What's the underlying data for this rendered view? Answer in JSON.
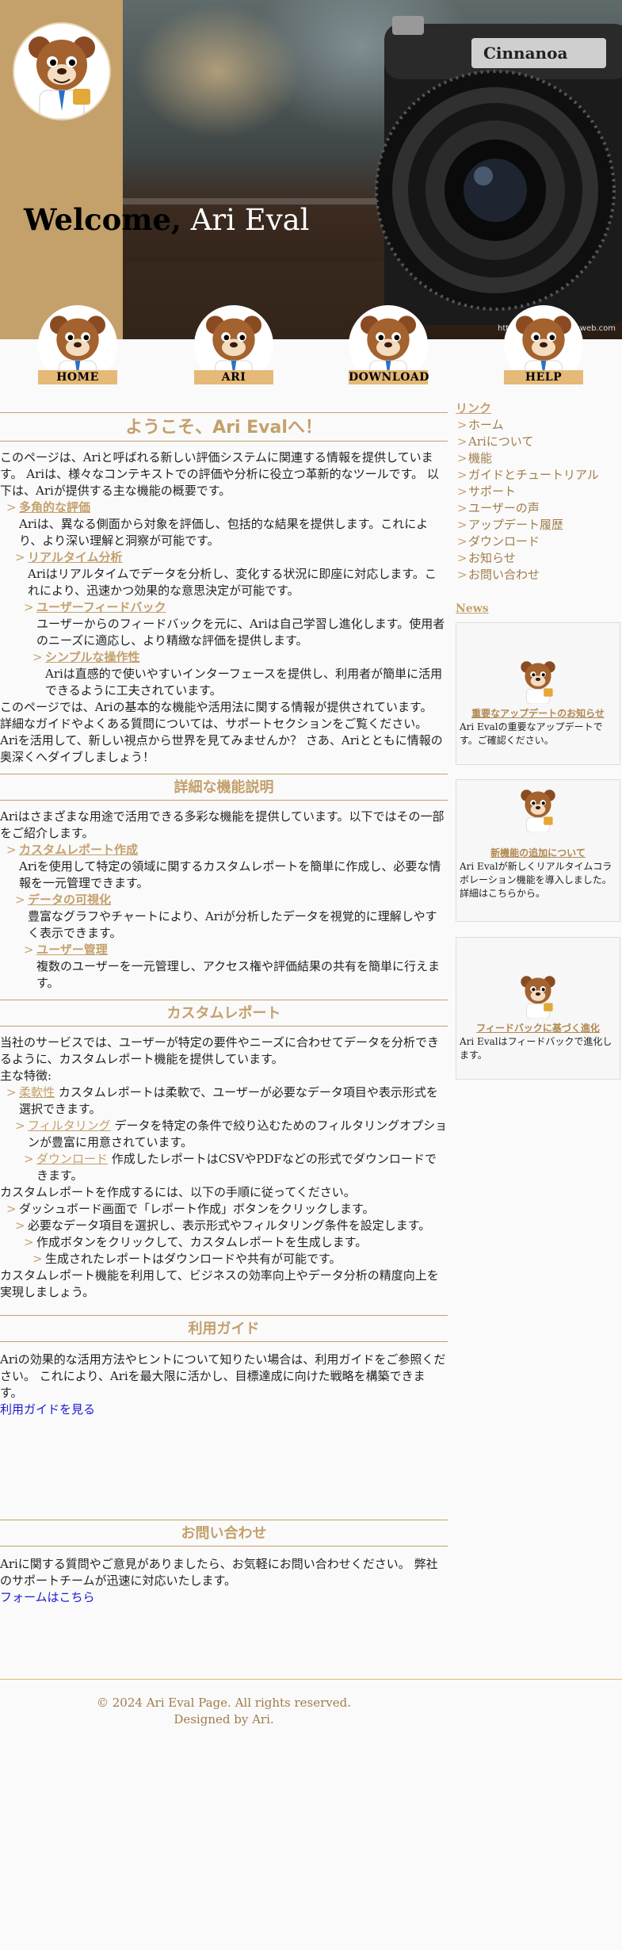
{
  "header": {
    "welcome_word": "Welcome,",
    "welcome_name": "Ari Eval",
    "camera_brand": "Cinnanoa",
    "watermark": "https://www.ari.openweb.com"
  },
  "nav": [
    {
      "label": "HOME"
    },
    {
      "label": "ARI"
    },
    {
      "label": "DOWNLOAD"
    },
    {
      "label": "HELP"
    }
  ],
  "intro": {
    "title": "ようこそ、Ari Evalへ！",
    "p1": "このページは、Ariと呼ばれる新しい評価システムに関連する情報を提供しています。 Ariは、様々なコンテキストでの評価や分析に役立つ革新的なツールです。 以下は、Ariが提供する主な機能の概要です。",
    "items": [
      {
        "title": "多角的な評価",
        "text": "Ariは、異なる側面から対象を評価し、包括的な結果を提供します。これにより、より深い理解と洞察が可能です。"
      },
      {
        "title": "リアルタイム分析",
        "text": "Ariはリアルタイムでデータを分析し、変化する状況に即座に対応します。これにより、迅速かつ効果的な意思決定が可能です。"
      },
      {
        "title": "ユーザーフィードバック",
        "text": "ユーザーからのフィードバックを元に、Ariは自己学習し進化します。使用者のニーズに適応し、より精緻な評価を提供します。"
      },
      {
        "title": "シンプルな操作性",
        "text": "Ariは直感的で使いやすいインターフェースを提供し、利用者が簡単に活用できるように工夫されています。"
      }
    ],
    "p2": "このページでは、Ariの基本的な機能や活用法に関する情報が提供されています。 詳細なガイドやよくある質問については、サポートセクションをご覧ください。 Ariを活用して、新しい視点から世界を見てみませんか？ さあ、Ariとともに情報の奥深くへダイブしましょう！"
  },
  "features": {
    "title": "詳細な機能説明",
    "p1": "Ariはさまざまな用途で活用できる多彩な機能を提供しています。以下ではその一部をご紹介します。",
    "items": [
      {
        "title": "カスタムレポート作成",
        "text": "Ariを使用して特定の領域に関するカスタムレポートを簡単に作成し、必要な情報を一元管理できます。"
      },
      {
        "title": "データの可視化",
        "text": "豊富なグラフやチャートにより、Ariが分析したデータを視覚的に理解しやすく表示できます。"
      },
      {
        "title": "ユーザー管理",
        "text": "複数のユーザーを一元管理し、アクセス権や評価結果の共有を簡単に行えます。"
      }
    ]
  },
  "report": {
    "title": "カスタムレポート",
    "p1": "当社のサービスでは、ユーザーが特定の要件やニーズに合わせてデータを分析できるように、カスタムレポート機能を提供しています。",
    "features_label": "主な特徴:",
    "bullets": [
      {
        "link": "柔軟性",
        "text": "カスタムレポートは柔軟で、ユーザーが必要なデータ項目や表示形式を選択できます。"
      },
      {
        "link": "フィルタリング",
        "text": "データを特定の条件で絞り込むためのフィルタリングオプションが豊富に用意されています。"
      },
      {
        "link": "ダウンロード",
        "text": "作成したレポートはCSVやPDFなどの形式でダウンロードできます。"
      }
    ],
    "steps_intro": "カスタムレポートを作成するには、以下の手順に従ってください。",
    "steps": [
      "ダッシュボード画面で「レポート作成」ボタンをクリックします。",
      "必要なデータ項目を選択し、表示形式やフィルタリング条件を設定します。",
      "作成ボタンをクリックして、カスタムレポートを生成します。",
      "生成されたレポートはダウンロードや共有が可能です。"
    ],
    "p_end": "カスタムレポート機能を利用して、ビジネスの効率向上やデータ分析の精度向上を実現しましょう。"
  },
  "guide": {
    "title": "利用ガイド",
    "p1": "Ariの効果的な活用方法やヒントについて知りたい場合は、利用ガイドをご参照ください。 これにより、Ariを最大限に活かし、目標達成に向けた戦略を構築できます。",
    "link": "利用ガイドを見る"
  },
  "contact": {
    "title": "お問い合わせ",
    "p1": "Ariに関する質問やご意見がありましたら、お気軽にお問い合わせください。 弊社のサポートチームが迅速に対応いたします。",
    "link": "フォームはこちら"
  },
  "sidebar": {
    "links_title": "リンク",
    "links": [
      "ホーム",
      "Ariについて",
      "機能",
      "ガイドとチュートリアル",
      "サポート",
      "ユーザーの声",
      "アップデート履歴",
      "ダウンロード",
      "お知らせ",
      "お問い合わせ"
    ],
    "news_title": "News",
    "news": [
      {
        "title": "重要なアップデートのお知らせ",
        "text": "Ari Evalの重要なアップデートです。ご確認ください。"
      },
      {
        "title": "新機能の追加について",
        "text": "Ari Evalが新しくリアルタイムコラボレーション機能を導入しました。",
        "more": "詳細はこちらから。"
      },
      {
        "title": "フィードバックに基づく進化",
        "text": "Ari Evalはフィードバックで進化します。"
      }
    ]
  },
  "footer": {
    "copyright": "© 2024 Ari Eval Page. All rights reserved.",
    "designed": "Designed by Ari."
  }
}
